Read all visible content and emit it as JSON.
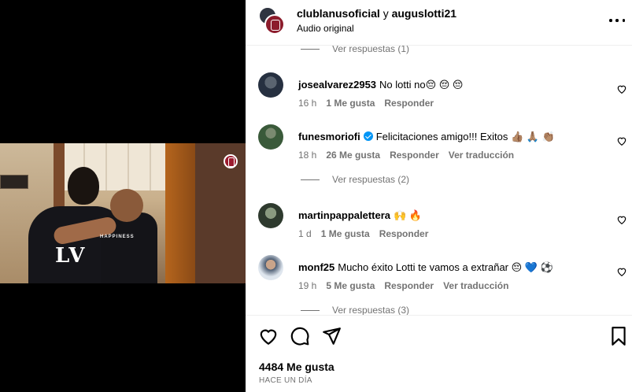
{
  "post": {
    "author_primary": "clublanusoficial",
    "connector": "y",
    "author_secondary": "auguslotti21",
    "audio": "Audio original"
  },
  "video": {
    "shirt_big": "LV",
    "shirt_small": "HAPPINESS"
  },
  "comments": [
    {
      "type": "replies",
      "label": "Ver respuestas (1)"
    },
    {
      "type": "comment",
      "user": "josealvarez2953",
      "text": "No lotti no😔 😔 😔",
      "time": "16 h",
      "likes": "1 Me gusta",
      "reply": "Responder",
      "translate": "",
      "verified": false
    },
    {
      "type": "comment",
      "user": "funesmoriofi",
      "text": "Felicitaciones amigo!!! Exitos 👍🏽 🙏🏽 👏🏽",
      "time": "18 h",
      "likes": "26 Me gusta",
      "reply": "Responder",
      "translate": "Ver traducción",
      "verified": true
    },
    {
      "type": "replies",
      "label": "Ver respuestas (2)"
    },
    {
      "type": "comment",
      "user": "martinpappalettera",
      "text": "🙌 🔥",
      "time": "1 d",
      "likes": "1 Me gusta",
      "reply": "Responder",
      "translate": "",
      "verified": false
    },
    {
      "type": "comment",
      "user": "monf25",
      "text": "Mucho éxito Lotti te vamos a extrañar 😔 💙 ⚽",
      "time": "19 h",
      "likes": "5 Me gusta",
      "reply": "Responder",
      "translate": "Ver traducción",
      "verified": false
    },
    {
      "type": "replies",
      "label": "Ver respuestas (3)"
    }
  ],
  "footer": {
    "likes": "4484 Me gusta",
    "time_ago": "HACE UN DÍA"
  },
  "colors": {
    "muted": "#737373",
    "verified": "#0095f6",
    "club": "#8c1c2c"
  },
  "icons": {
    "like": "heart-icon",
    "comment": "comment-icon",
    "share": "paper-plane-icon",
    "save": "bookmark-icon",
    "more": "more-options-icon"
  }
}
